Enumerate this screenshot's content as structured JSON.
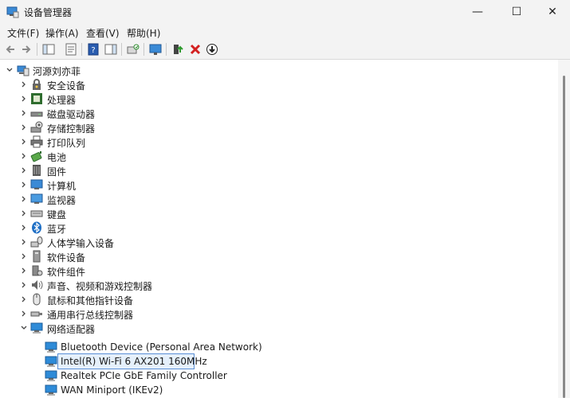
{
  "window": {
    "title": "设备管理器"
  },
  "controls": {
    "minimize": "—",
    "maximize": "☐",
    "close": "✕"
  },
  "menu": {
    "items": [
      {
        "label": "文件(F)"
      },
      {
        "label": "操作(A)"
      },
      {
        "label": "查看(V)"
      },
      {
        "label": "帮助(H)"
      }
    ]
  },
  "tree": {
    "root": {
      "label": "河源刘亦菲",
      "icon": "computer-icon"
    },
    "categories": [
      {
        "label": "安全设备",
        "icon": "security-device-icon"
      },
      {
        "label": "处理器",
        "icon": "processor-icon"
      },
      {
        "label": "磁盘驱动器",
        "icon": "disk-drive-icon"
      },
      {
        "label": "存储控制器",
        "icon": "storage-controller-icon"
      },
      {
        "label": "打印队列",
        "icon": "printer-icon"
      },
      {
        "label": "电池",
        "icon": "battery-icon"
      },
      {
        "label": "固件",
        "icon": "firmware-icon"
      },
      {
        "label": "计算机",
        "icon": "monitor-icon"
      },
      {
        "label": "监视器",
        "icon": "monitor-icon"
      },
      {
        "label": "键盘",
        "icon": "keyboard-icon"
      },
      {
        "label": "蓝牙",
        "icon": "bluetooth-icon"
      },
      {
        "label": "人体学输入设备",
        "icon": "hid-icon"
      },
      {
        "label": "软件设备",
        "icon": "software-device-icon"
      },
      {
        "label": "软件组件",
        "icon": "software-component-icon"
      },
      {
        "label": "声音、视频和游戏控制器",
        "icon": "sound-icon"
      },
      {
        "label": "鼠标和其他指针设备",
        "icon": "mouse-icon"
      },
      {
        "label": "通用串行总线控制器",
        "icon": "usb-icon"
      },
      {
        "label": "网络适配器",
        "icon": "network-adapter-icon",
        "expanded": true
      }
    ],
    "network_adapters": [
      {
        "label": "Bluetooth Device (Personal Area Network)"
      },
      {
        "label": "Intel(R) Wi-Fi 6 AX201 160MHz",
        "selected": true
      },
      {
        "label": "Realtek PCIe GbE Family Controller"
      },
      {
        "label": "WAN Miniport (IKEv2)"
      }
    ]
  },
  "colors": {
    "selection_border": "#5a8fd6",
    "selection_fill": "#e5f0fb",
    "network_icon": "#2e8bd8",
    "delete_icon": "#d32020"
  }
}
